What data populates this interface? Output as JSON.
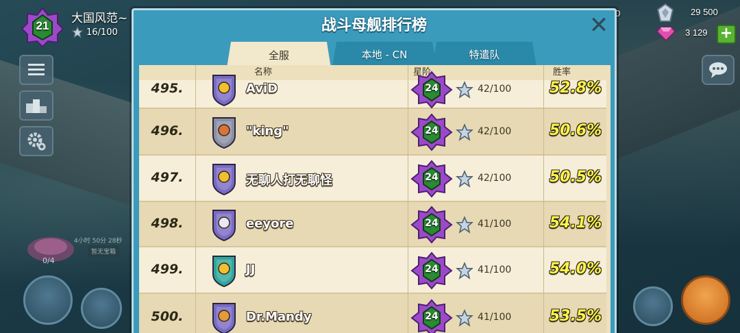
{
  "player": {
    "level": "21",
    "name": "大国风范~",
    "stars": "16/100"
  },
  "resources": {
    "top_value": "0",
    "crystals": "29 500",
    "gems": "3 129",
    "add_label": "+"
  },
  "chest": {
    "timer": "4小时 50分 28秒",
    "status": "暂无宝箱",
    "count": "0/4"
  },
  "panel": {
    "title": "战斗母舰排行榜",
    "close_label": "✕",
    "tabs": [
      {
        "label": "全服",
        "active": true
      },
      {
        "label": "本地 - CN",
        "active": false
      },
      {
        "label": "特遣队",
        "active": false
      }
    ],
    "headers": {
      "name": "名称",
      "rank": "星阶",
      "winrate": "胜率"
    }
  },
  "rows": [
    {
      "position": "495.",
      "name": "AviD",
      "rank": "24",
      "stars": "42/100",
      "winrate": "52.8%",
      "shield_color": "#7a6bc4",
      "emblem_color": "#f0c030"
    },
    {
      "position": "496.",
      "name": "\"king\"",
      "rank": "24",
      "stars": "42/100",
      "winrate": "50.6%",
      "shield_color": "#8b8fa3",
      "emblem_color": "#d9733a"
    },
    {
      "position": "497.",
      "name": "无聊人打无聊怪",
      "rank": "24",
      "stars": "42/100",
      "winrate": "50.5%",
      "shield_color": "#7a6bc4",
      "emblem_color": "#f0c030"
    },
    {
      "position": "498.",
      "name": "eeyore",
      "rank": "24",
      "stars": "41/100",
      "winrate": "54.1%",
      "shield_color": "#7a6bc4",
      "emblem_color": "#e8e8f0"
    },
    {
      "position": "499.",
      "name": "JJ",
      "rank": "24",
      "stars": "41/100",
      "winrate": "54.0%",
      "shield_color": "#2fa79a",
      "emblem_color": "#f0c030"
    },
    {
      "position": "500.",
      "name": "Dr.Mandy",
      "rank": "24",
      "stars": "41/100",
      "winrate": "53.5%",
      "shield_color": "#7a6bc4",
      "emblem_color": "#e59a3a"
    }
  ],
  "colors": {
    "panel_blue": "#3b9bbd",
    "table_bg": "#ede0bd",
    "winrate_yellow": "#fff34a",
    "rank_badge_purple": "#9c49c9",
    "rank_badge_green": "#2b8a34"
  }
}
